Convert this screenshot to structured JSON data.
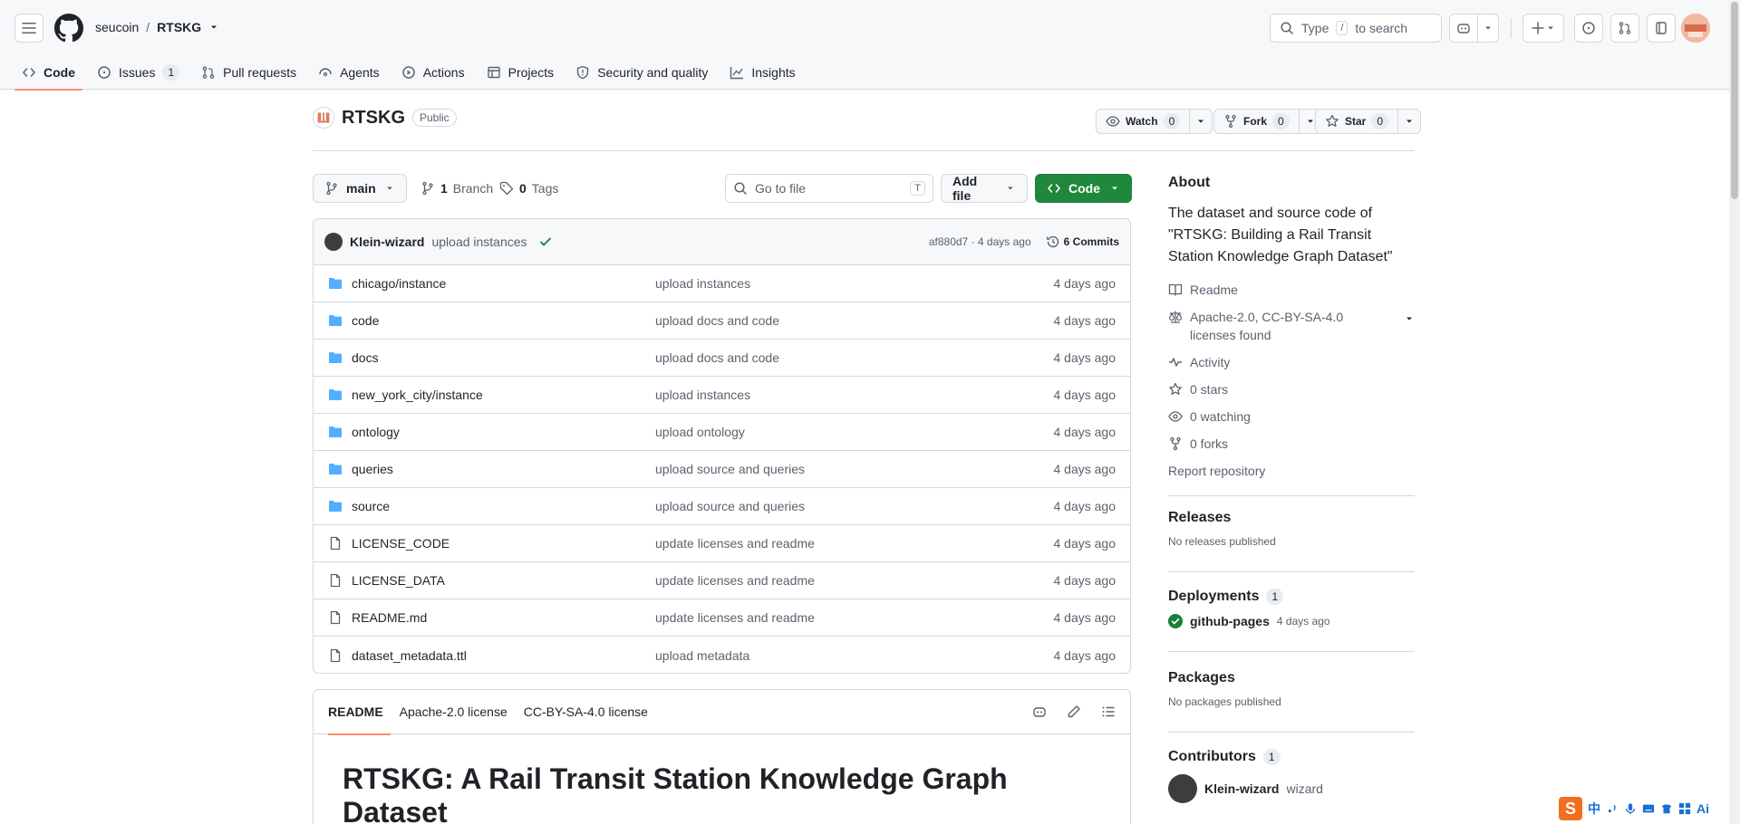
{
  "header": {
    "owner": "seucoin",
    "separator": "/",
    "repo": "RTSKG",
    "search_prefix": "Type",
    "search_key": "/",
    "search_suffix": "to search"
  },
  "tabs": [
    {
      "label": "Code",
      "icon": "code-icon"
    },
    {
      "label": "Issues",
      "icon": "issue-opened-icon",
      "count": "1"
    },
    {
      "label": "Pull requests",
      "icon": "git-pull-request-icon"
    },
    {
      "label": "Agents",
      "icon": "agent-icon"
    },
    {
      "label": "Actions",
      "icon": "play-icon"
    },
    {
      "label": "Projects",
      "icon": "table-icon"
    },
    {
      "label": "Security and quality",
      "icon": "shield-icon"
    },
    {
      "label": "Insights",
      "icon": "graph-icon"
    }
  ],
  "repo": {
    "name": "RTSKG",
    "visibility": "Public",
    "watch_label": "Watch",
    "watch_count": "0",
    "fork_label": "Fork",
    "fork_count": "0",
    "star_label": "Star",
    "star_count": "0"
  },
  "filenav": {
    "branch": "main",
    "branches_count": "1",
    "branches_label": "Branch",
    "tags_count": "0",
    "tags_label": "Tags",
    "goto_placeholder": "Go to file",
    "goto_key": "T",
    "add_file": "Add file",
    "code": "Code"
  },
  "commit": {
    "author": "Klein-wizard",
    "message": "upload instances",
    "hash": "af880d7",
    "sep": "·",
    "time": "4 days ago",
    "commits_label": "6 Commits"
  },
  "files": [
    {
      "name": "chicago/instance",
      "type": "dir",
      "message": "upload instances",
      "date": "4 days ago"
    },
    {
      "name": "code",
      "type": "dir",
      "message": "upload docs and code",
      "date": "4 days ago"
    },
    {
      "name": "docs",
      "type": "dir",
      "message": "upload docs and code",
      "date": "4 days ago"
    },
    {
      "name": "new_york_city/instance",
      "type": "dir",
      "message": "upload instances",
      "date": "4 days ago"
    },
    {
      "name": "ontology",
      "type": "dir",
      "message": "upload ontology",
      "date": "4 days ago"
    },
    {
      "name": "queries",
      "type": "dir",
      "message": "upload source and queries",
      "date": "4 days ago"
    },
    {
      "name": "source",
      "type": "dir",
      "message": "upload source and queries",
      "date": "4 days ago"
    },
    {
      "name": "LICENSE_CODE",
      "type": "file",
      "message": "update licenses and readme",
      "date": "4 days ago"
    },
    {
      "name": "LICENSE_DATA",
      "type": "file",
      "message": "update licenses and readme",
      "date": "4 days ago"
    },
    {
      "name": "README.md",
      "type": "file",
      "message": "update licenses and readme",
      "date": "4 days ago"
    },
    {
      "name": "dataset_metadata.ttl",
      "type": "file",
      "message": "upload metadata",
      "date": "4 days ago"
    }
  ],
  "readme": {
    "tabs": [
      "README",
      "Apache-2.0 license",
      "CC-BY-SA-4.0 license"
    ],
    "heading": "RTSKG: A Rail Transit Station Knowledge Graph Dataset"
  },
  "about": {
    "title": "About",
    "description": "The dataset and source code of \"RTSKG: Building a Rail Transit Station Knowledge Graph Dataset\"",
    "readme": "Readme",
    "license": "Apache-2.0, CC-BY-SA-4.0 licenses found",
    "activity": "Activity",
    "stars": "0 stars",
    "watching": "0 watching",
    "forks": "0 forks",
    "report": "Report repository"
  },
  "releases": {
    "title": "Releases",
    "note": "No releases published"
  },
  "deployments": {
    "title": "Deployments",
    "count": "1",
    "env": "github-pages",
    "time": "4 days ago"
  },
  "packages": {
    "title": "Packages",
    "note": "No packages published"
  },
  "contributors": {
    "title": "Contributors",
    "count": "1",
    "login": "Klein-wizard",
    "name": "wizard"
  },
  "ime": {
    "logo": "S",
    "label": "中",
    "ai": "Ai"
  },
  "colors": {
    "accent_green": "#1f883d",
    "tab_underline": "#fd8c73",
    "folder": "#54aeff",
    "link": "#0969da"
  }
}
